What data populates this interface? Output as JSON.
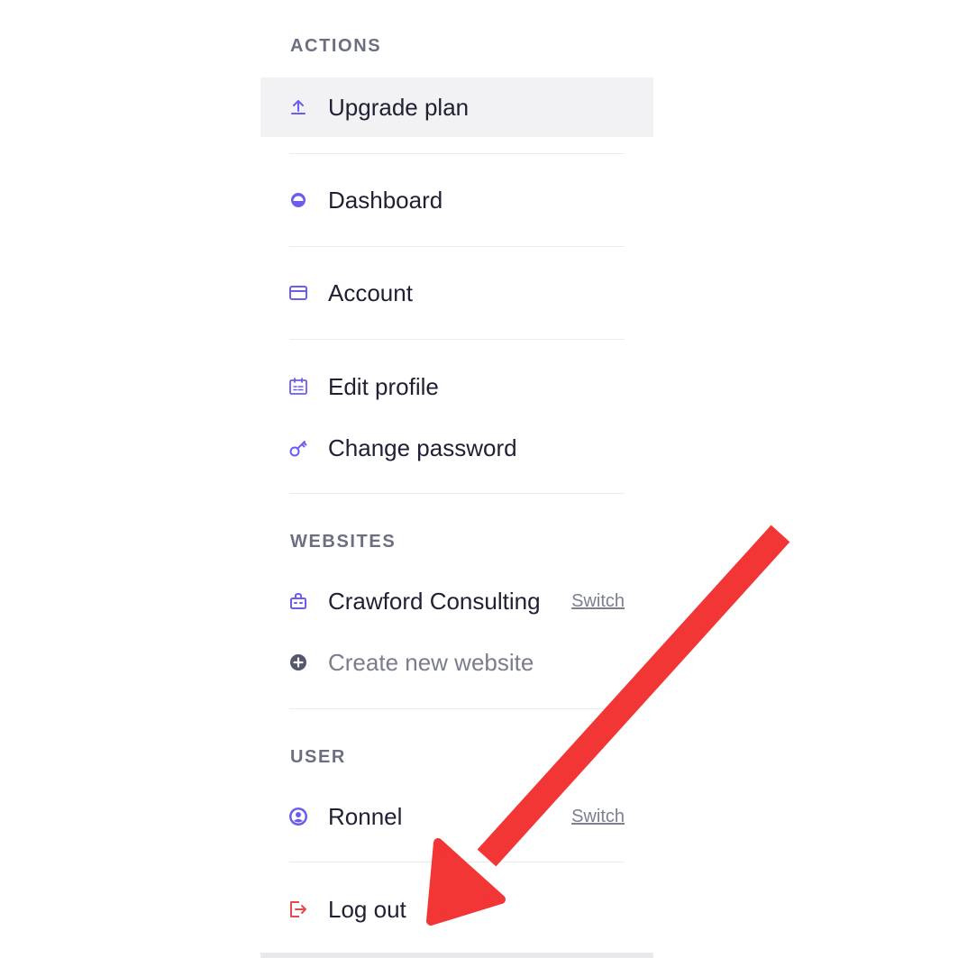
{
  "sections": {
    "actions": {
      "header": "ACTIONS",
      "upgrade": {
        "label": "Upgrade plan",
        "icon": "upload-icon"
      },
      "dashboard": {
        "label": "Dashboard",
        "icon": "dashboard-gauge-icon"
      },
      "account": {
        "label": "Account",
        "icon": "credit-card-icon"
      },
      "edit_profile": {
        "label": "Edit profile",
        "icon": "id-card-icon"
      },
      "change_password": {
        "label": "Change password",
        "icon": "key-icon"
      }
    },
    "websites": {
      "header": "WEBSITES",
      "current": {
        "label": "Crawford Consulting",
        "switch_label": "Switch",
        "icon": "store-icon"
      },
      "create": {
        "label": "Create new website",
        "icon": "plus-circle-icon"
      }
    },
    "user": {
      "header": "USER",
      "current": {
        "label": "Ronnel",
        "switch_label": "Switch",
        "icon": "user-circle-icon"
      },
      "logout": {
        "label": "Log out",
        "icon": "logout-icon"
      }
    }
  },
  "colors": {
    "accent": "#6b5cf0",
    "logout": "#e5484d",
    "annotation_arrow": "#f23535"
  }
}
